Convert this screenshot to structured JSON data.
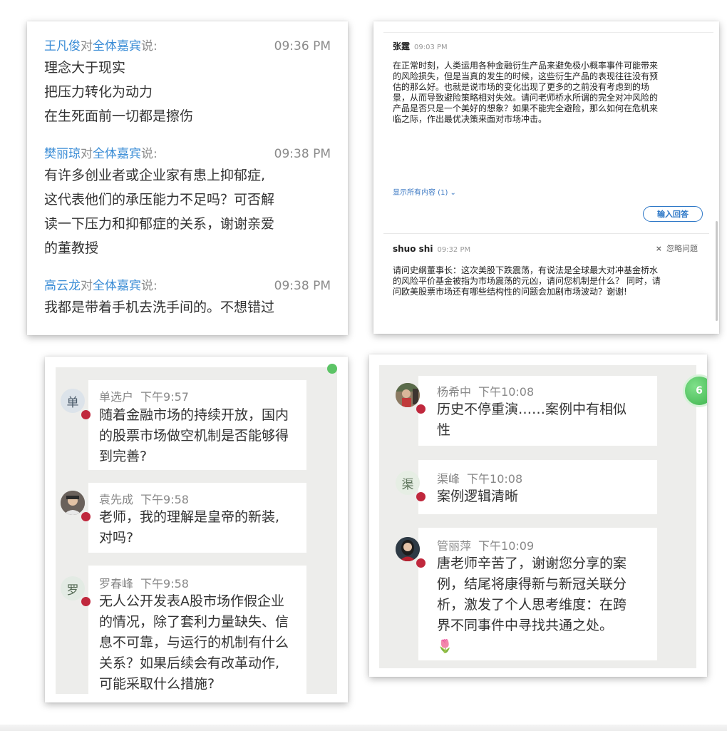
{
  "panel1": {
    "messages": [
      {
        "sender": "王凡俊",
        "to_prefix": "对",
        "to": "全体嘉宾",
        "said": "说:",
        "time": "09:36 PM",
        "lines": [
          "理念大于现实",
          "把压力转化为动力",
          "在生死面前一切都是擦伤"
        ]
      },
      {
        "sender": "樊丽琼",
        "to_prefix": "对",
        "to": "全体嘉宾",
        "said": "说:",
        "time": "09:38 PM",
        "lines": [
          "有许多创业者或企业家有患上抑郁症,",
          "这代表他们的承压能力不足吗？可否解",
          "读一下压力和抑郁症的关系，谢谢亲爱",
          "的董教授"
        ]
      },
      {
        "sender": "高云龙",
        "to_prefix": "对",
        "to": "全体嘉宾",
        "said": "说:",
        "time": "09:38 PM",
        "lines": [
          "我都是带着手机去洗手间的。不想错过"
        ]
      }
    ]
  },
  "panel2": {
    "question1": {
      "name": "张霆",
      "time": "09:03 PM",
      "lines": [
        "在正常时刻，人类运用各种金融衍生产品来避免极小概率事件可能带来",
        "的风险损失，但是当真的发生的时候，这些衍生产品的表现往往没有预",
        "估的那么好。也就是说市场的变化出现了更多的之前没有考虑到的场",
        "景，从而导致避险策略相对失效。请问老师桥水所谓的完全对冲风险的",
        "产品是否只是一个美好的想象？如果不能完全避险，那么如何在危机来",
        "临之际，作出最优决策来面对市场冲击。"
      ]
    },
    "show_all": "显示所有内容 (1) ⌄",
    "answer_button": "输入回答",
    "question2": {
      "name": "shuo shi",
      "time": "09:32 PM",
      "ignore": "忽略问题",
      "lines": [
        "请问史纲董事长：这次美股下跌震荡，有说法是全球最大对冲基金桥水",
        "的风险平价基金被指为市场震荡的元凶，请问您机制是什么？ 同时，请",
        "问欧美股票市场还有哪些结构性的问题会加剧市场波动？谢谢!"
      ]
    }
  },
  "panel3": {
    "messages": [
      {
        "avatar": "单",
        "name": "单选户",
        "time": "下午9:57",
        "lines": [
          "随着金融市场的持续开放，国内",
          "的股票市场做空机制是否能够得",
          "到完善?"
        ]
      },
      {
        "avatar": "",
        "name": "袁先成",
        "time": "下午9:58",
        "lines": [
          "老师，我的理解是皇帝的新装,",
          "对吗?"
        ]
      },
      {
        "avatar": "罗",
        "name": "罗春峰",
        "time": "下午9:58",
        "lines": [
          "无人公开发表A股市场作假企业",
          "的情况，除了套利力量缺失、信",
          "息不可靠，与运行的机制有什么",
          "关系？如果后续会有改革动作,",
          "可能采取什么措施?"
        ]
      }
    ]
  },
  "panel4": {
    "badge": "6",
    "messages": [
      {
        "avatar": "",
        "name": "杨希中",
        "time": "下午10:08",
        "lines": [
          "历史不停重演……案例中有相似",
          "性"
        ]
      },
      {
        "avatar": "渠",
        "name": "渠峰",
        "time": "下午10:08",
        "lines": [
          "案例逻辑清晰"
        ]
      },
      {
        "avatar": "",
        "name": "管丽萍",
        "time": "下午10:09",
        "lines": [
          "唐老师辛苦了，谢谢您分享的案",
          "例，结尾将康得新与新冠关联分",
          "析，激发了个人思考维度：在跨",
          "界不同事件中寻找共通之处。"
        ],
        "emoji": "🌷"
      }
    ]
  }
}
